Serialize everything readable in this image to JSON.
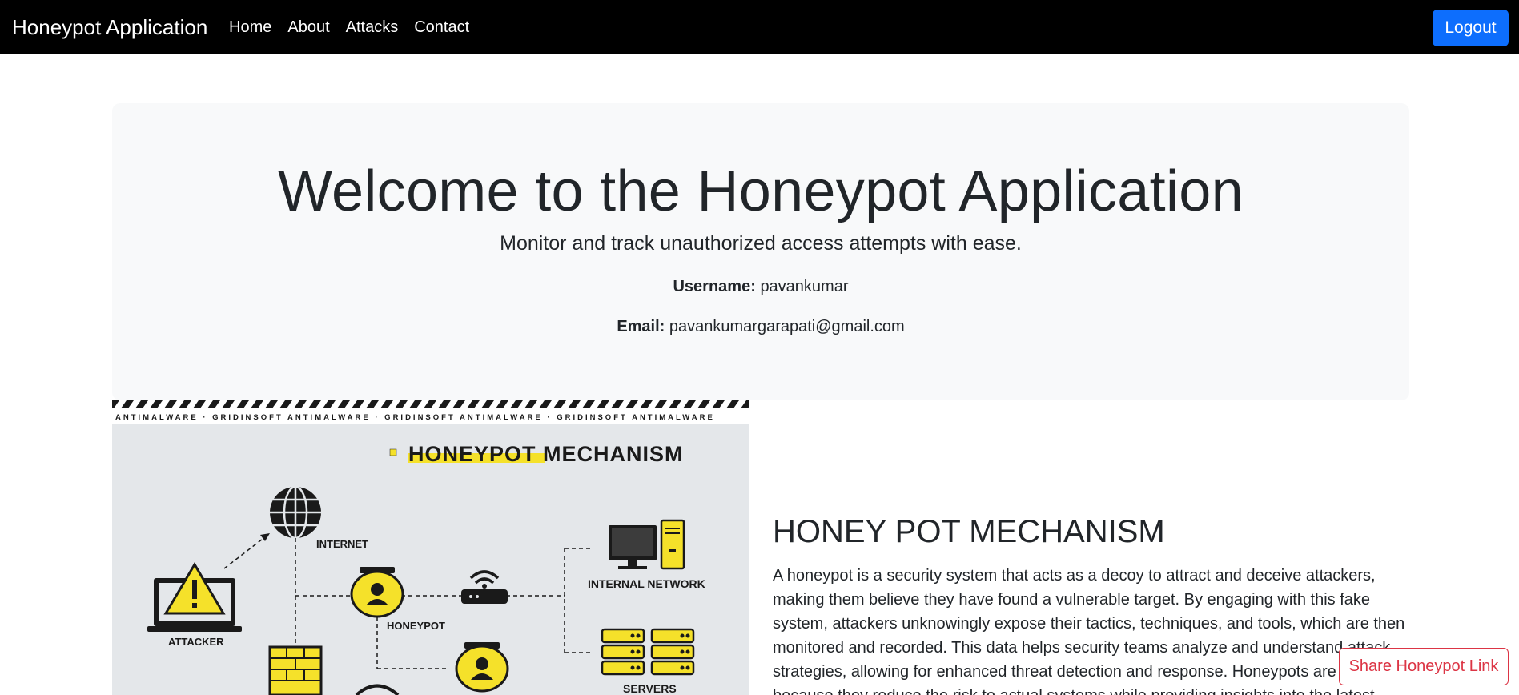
{
  "navbar": {
    "brand": "Honeypot Application",
    "links": [
      "Home",
      "About",
      "Attacks",
      "Contact"
    ],
    "logout_label": "Logout"
  },
  "hero": {
    "title": "Welcome to the Honeypot Application",
    "subtitle": "Monitor and track unauthorized access attempts with ease.",
    "username_label": "Username:",
    "username_value": "pavankumar",
    "email_label": "Email:",
    "email_value": "pavankumargarapati@gmail.com"
  },
  "diagram": {
    "banner_text": "ANTIMALWARE · GRIDINSOFT ANTIMALWARE · GRIDINSOFT ANTIMALWARE · GRIDINSOFT ANTIMALWARE",
    "title": "HONEYPOT MECHANISM",
    "labels": {
      "internet": "INTERNET",
      "attacker": "ATTACKER",
      "honeypot": "HONEYPOT",
      "internal_network": "INTERNAL NETWORK",
      "servers": "SERVERS"
    },
    "colors": {
      "accent": "#f5e12a",
      "background": "#e4e7ea",
      "ink": "#1a1a1a"
    }
  },
  "mechanism": {
    "title": "HONEY POT MECHANISM",
    "text": "A honeypot is a security system that acts as a decoy to attract and deceive attackers, making them believe they have found a vulnerable target. By engaging with this fake system, attackers unknowingly expose their tactics, techniques, and tools, which are then monitored and recorded. This data helps security teams analyze and understand attack strategies, allowing for enhanced threat detection and response. Honeypots are valuable because they reduce the risk to actual systems while providing insights into the latest"
  },
  "share_button": {
    "label": "Share Honeypot Link"
  },
  "colors": {
    "navbar": "#000000",
    "primary": "#0d6efd",
    "danger": "#dc3545",
    "hero_bg": "#f8f9fa"
  }
}
